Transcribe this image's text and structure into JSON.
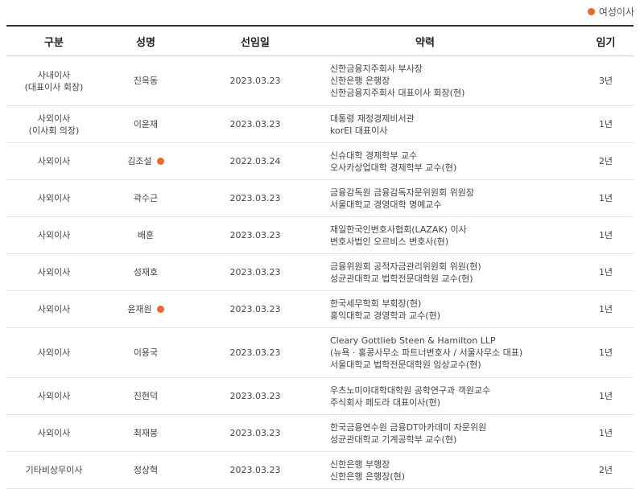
{
  "legend": {
    "label": "여성이사",
    "color": "#e9692c"
  },
  "headers": [
    "구분",
    "성명",
    "선임일",
    "약력",
    "임기"
  ],
  "rows": [
    {
      "category": [
        "사내이사",
        "(대표이사 회장)"
      ],
      "name": "진옥동",
      "female": false,
      "date": "2023.03.23",
      "career": [
        "신한금융지주회사 부사장",
        "신한은행 은행장",
        "신한금융지주회사 대표이사 회장(현)"
      ],
      "term": "3년"
    },
    {
      "category": [
        "사외이사",
        "(이사회 의장)"
      ],
      "name": "이윤재",
      "female": false,
      "date": "2023.03.23",
      "career": [
        "대통령 재정경제비서관",
        "korEI 대표이사"
      ],
      "term": "1년"
    },
    {
      "category": [
        "사외이사"
      ],
      "name": "김조설",
      "female": true,
      "date": "2022.03.24",
      "career": [
        "신슈대학 경제학부 교수",
        "오사카상업대학 경제학부 교수(현)"
      ],
      "term": "2년"
    },
    {
      "category": [
        "사외이사"
      ],
      "name": "곽수근",
      "female": false,
      "date": "2023.03.23",
      "career": [
        "금융감독원 금융감독자문위원회 위원장",
        "서울대학교 경영대학 명예교수"
      ],
      "term": "1년"
    },
    {
      "category": [
        "사외이사"
      ],
      "name": "배훈",
      "female": false,
      "date": "2023.03.23",
      "career": [
        "재일한국인변호사협회(LAZAK) 이사",
        "변호사법인 오르비스 변호사(현)"
      ],
      "term": "1년"
    },
    {
      "category": [
        "사외이사"
      ],
      "name": "성재호",
      "female": false,
      "date": "2023.03.23",
      "career": [
        "금융위원회 공적자금관리위원회 위원(현)",
        "성균관대학교 법학전문대학원 교수(현)"
      ],
      "term": "1년"
    },
    {
      "category": [
        "사외이사"
      ],
      "name": "윤재원",
      "female": true,
      "date": "2023.03.23",
      "career": [
        "한국세무학회 부회장(현)",
        "홍익대학교 경영학과 교수(현)"
      ],
      "term": "1년"
    },
    {
      "category": [
        "사외이사"
      ],
      "name": "이용국",
      "female": false,
      "date": "2023.03.23",
      "career": [
        "Cleary Gottlieb Steen & Hamilton LLP",
        "(뉴욕 · 홍콩사무소 파트너변호사 / 서울사무소 대표)",
        "서울대학교 법학전문대학원 임상교수(현)"
      ],
      "term": "1년"
    },
    {
      "category": [
        "사외이사"
      ],
      "name": "진현덕",
      "female": false,
      "date": "2023.03.23",
      "career": [
        "우츠노미야대학대학원 공학연구과 객원교수",
        "주식회사 페도라 대표이사(현)"
      ],
      "term": "1년"
    },
    {
      "category": [
        "사외이사"
      ],
      "name": "최재붕",
      "female": false,
      "date": "2023.03.23",
      "career": [
        "한국금융연수원 금융DT아카데미 자문위원",
        "성균관대학교 기계공학부 교수(현)"
      ],
      "term": "1년"
    },
    {
      "category": [
        "기타비상무이사"
      ],
      "name": "정상혁",
      "female": false,
      "date": "2023.03.23",
      "career": [
        "신한은행 부행장",
        "신한은행 은행장(현)"
      ],
      "term": "2년"
    }
  ]
}
